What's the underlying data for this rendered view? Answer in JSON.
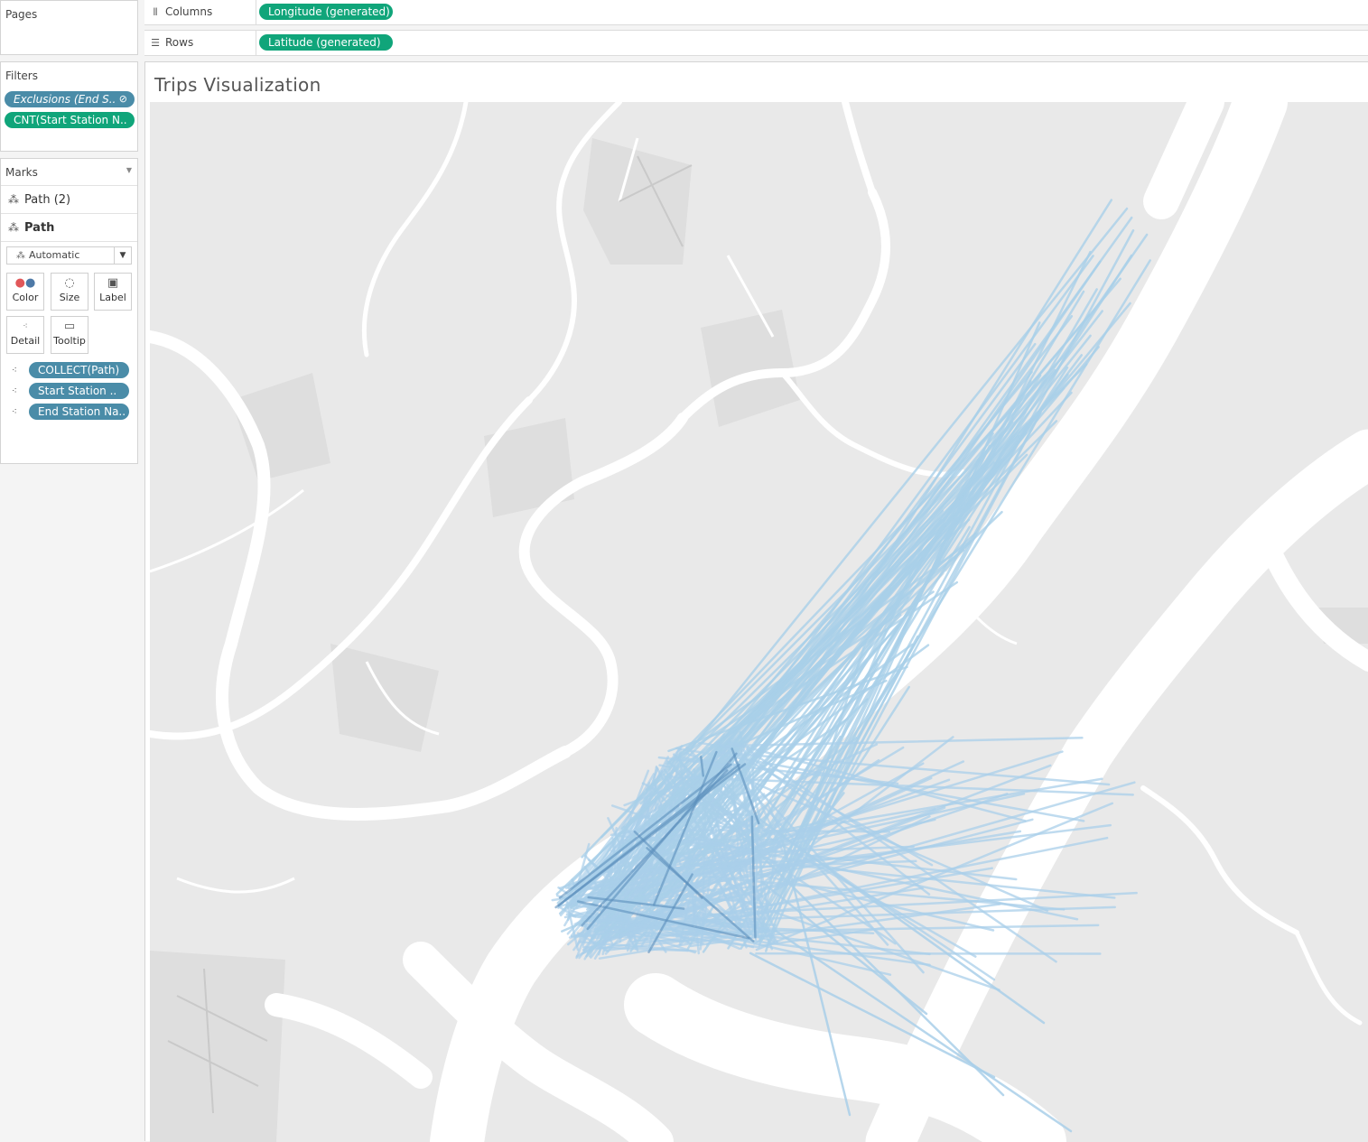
{
  "pages": {
    "title": "Pages"
  },
  "columns": {
    "label": "Columns",
    "pill": "Longitude (generated)"
  },
  "rows": {
    "label": "Rows",
    "pill": "Latitude (generated)"
  },
  "filters": {
    "title": "Filters",
    "items": [
      "Exclusions (End S..",
      "CNT(Start Station N.."
    ]
  },
  "marks": {
    "title": "Marks",
    "layers": [
      "Path (2)",
      "Path"
    ],
    "mark_type": "Automatic",
    "buttons": {
      "color": "Color",
      "size": "Size",
      "label": "Label",
      "detail": "Detail",
      "tooltip": "Tooltip"
    },
    "fields": [
      "COLLECT(Path)",
      "Start Station ..",
      "End Station Na.."
    ]
  },
  "view": {
    "title": "Trips Visualization"
  },
  "colors": {
    "accent_green": "#10a57a",
    "pill_blue": "#4a8ca8",
    "path_line": "#a9cfe9",
    "path_dense": "#5b8fbc"
  }
}
